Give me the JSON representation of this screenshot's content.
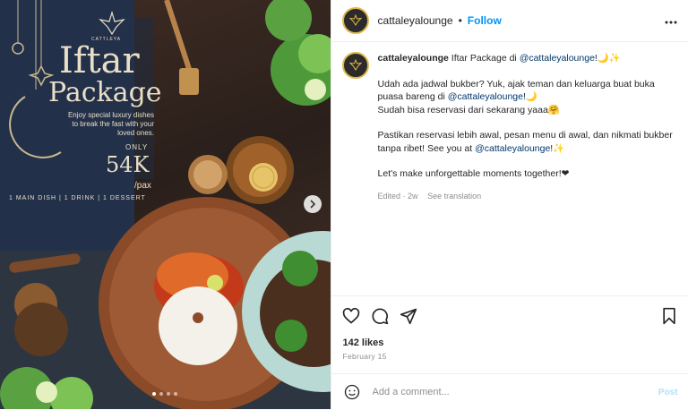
{
  "media": {
    "brand": "CATTLEYA",
    "title_line1": "Iftar",
    "title_line2": "Package",
    "subtitle": "Enjoy special luxury dishes to break the fast with your loved ones.",
    "price_prefix": "ONLY",
    "price": "54K",
    "price_unit": "/pax",
    "items": "1 MAIN DISH | 1 DRINK | 1 DESSERT",
    "next_icon": "chevron-right-icon",
    "slide_count": 4,
    "active_slide": 1
  },
  "header": {
    "username": "cattaleyalounge",
    "separator": "•",
    "follow_label": "Follow",
    "more_icon": "more-horizontal-icon"
  },
  "caption": {
    "username": "cattaleyalounge",
    "line1_text": " Iftar Package di ",
    "line1_mention": "@cattaleyalounge!",
    "line1_emoji": "🌙✨",
    "p2_text": "Udah ada jadwal bukber? Yuk, ajak teman dan keluarga buat buka puasa bareng di ",
    "p2_mention": "@cattaleyalounge!",
    "p2_emoji": "🌙",
    "p2_line2": "Sudah bisa reservasi dari sekarang yaaa🤗",
    "p3_text": "Pastikan reservasi lebih awal, pesan menu di awal, dan nikmati bukber tanpa ribet! See you at ",
    "p3_mention": "@cattaleyalounge!",
    "p3_emoji": "✨",
    "p4_text": "Let's make unforgettable moments together!❤",
    "edited": "Edited · 2w",
    "see_translation": "See translation"
  },
  "actions": {
    "like_icon": "heart-icon",
    "comment_icon": "comment-icon",
    "share_icon": "share-icon",
    "save_icon": "bookmark-icon",
    "likes": "142 likes",
    "date": "February 15"
  },
  "comment": {
    "emoji_icon": "emoji-icon",
    "placeholder": "Add a comment...",
    "post_label": "Post"
  },
  "colors": {
    "accent": "#0095f6",
    "mention": "#00376b",
    "muted": "#8e8e8e",
    "post_disabled": "#b2dffc",
    "gold": "#e0b64a"
  }
}
